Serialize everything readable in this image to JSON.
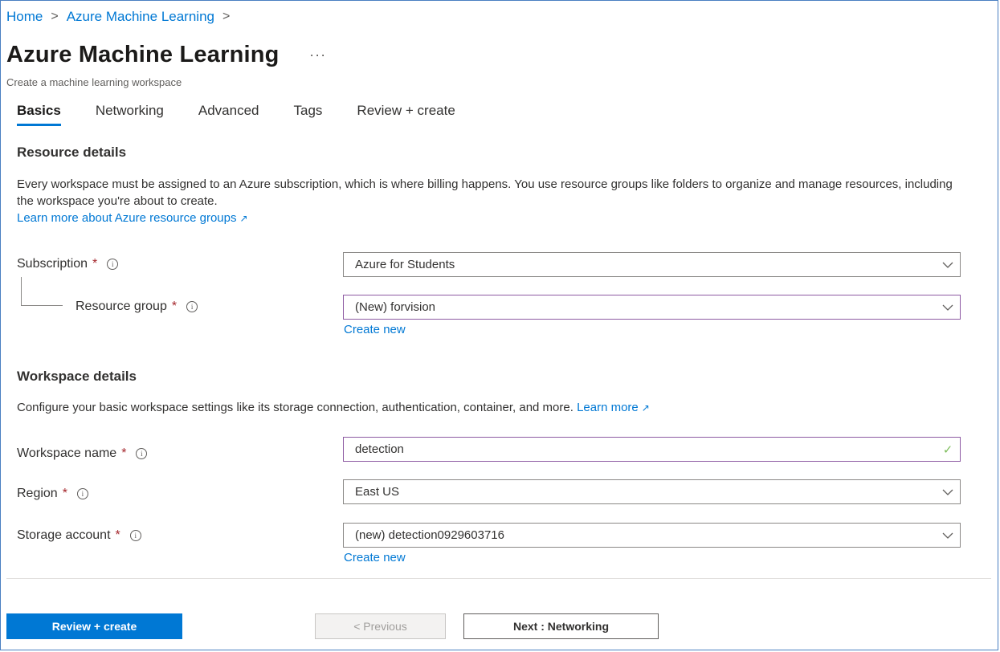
{
  "breadcrumb": {
    "home": "Home",
    "sep1": ">",
    "parent": "Azure Machine Learning",
    "sep2": ">"
  },
  "header": {
    "title": "Azure Machine Learning",
    "more": "...",
    "subtitle": "Create a machine learning workspace"
  },
  "tabs": [
    {
      "label": "Basics",
      "active": true
    },
    {
      "label": "Networking"
    },
    {
      "label": "Advanced"
    },
    {
      "label": "Tags"
    },
    {
      "label": "Review + create"
    }
  ],
  "resource_details": {
    "title": "Resource details",
    "description": "Every workspace must be assigned to an Azure subscription, which is where billing happens. You use resource groups like folders to organize and manage resources, including the workspace you're about to create.",
    "learn_more": "Learn more about Azure resource groups",
    "subscription": {
      "label": "Subscription",
      "required": "*",
      "value": "Azure for Students"
    },
    "resource_group": {
      "label": "Resource group",
      "required": "*",
      "value": "(New) forvision",
      "create_new": "Create new"
    }
  },
  "workspace_details": {
    "title": "Workspace details",
    "description": "Configure your basic workspace settings like its storage connection, authentication, container, and more.",
    "learn_more": "Learn more",
    "workspace_name": {
      "label": "Workspace name",
      "required": "*",
      "value": "detection"
    },
    "region": {
      "label": "Region",
      "required": "*",
      "value": "East US"
    },
    "storage_account": {
      "label": "Storage account",
      "required": "*",
      "value": "(new) detection0929603716",
      "create_new": "Create new"
    }
  },
  "footer": {
    "review_create": "Review + create",
    "previous": "< Previous",
    "next": "Next : Networking"
  },
  "icons": {
    "info": "i",
    "external": "external-link-icon",
    "check": "✓"
  },
  "colors": {
    "accent": "#0078d4",
    "required": "#a4262c",
    "valid": "#7dbd5b"
  }
}
